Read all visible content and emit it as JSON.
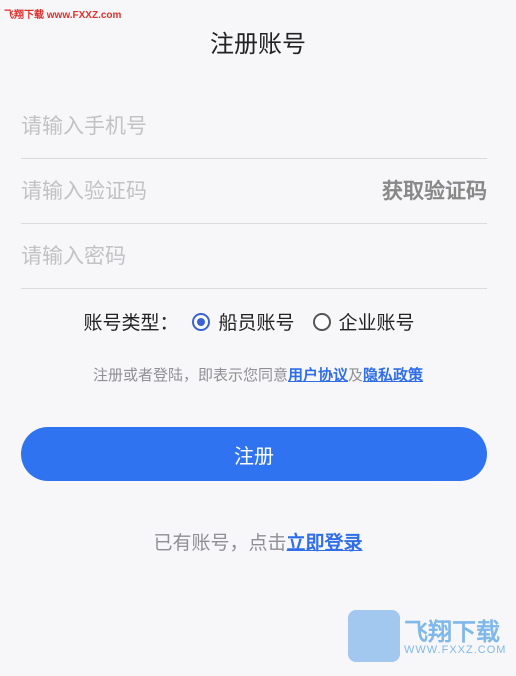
{
  "watermark": {
    "top_text": "飞翔下载 www.FXXZ.com",
    "corner_cn": "飞翔下载",
    "corner_domain": "WWW.FXXZ.COM"
  },
  "header": {
    "title": "注册账号"
  },
  "form": {
    "phone_placeholder": "请输入手机号",
    "code_placeholder": "请输入验证码",
    "get_code_label": "获取验证码",
    "password_placeholder": "请输入密码"
  },
  "account_type": {
    "label": "账号类型：",
    "options": [
      {
        "label": "船员账号",
        "selected": true
      },
      {
        "label": "企业账号",
        "selected": false
      }
    ]
  },
  "agreement": {
    "prefix": "注册或者登陆，即表示您同意",
    "user_agreement": "用户协议",
    "and": "及",
    "privacy_policy": "隐私政策"
  },
  "register_button": {
    "label": "注册"
  },
  "login_prompt": {
    "prefix": "已有账号，点击",
    "link": "立即登录"
  },
  "colors": {
    "accent": "#3073f1",
    "link": "#2f6ee8",
    "placeholder": "#c2c2c5"
  }
}
